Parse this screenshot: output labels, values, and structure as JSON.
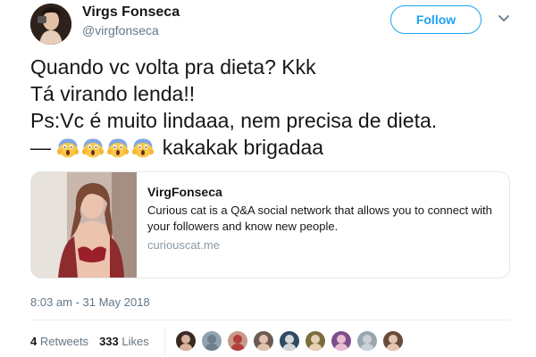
{
  "author": {
    "display_name": "Virgs Fonseca",
    "handle": "@virgfonseca"
  },
  "header": {
    "follow_label": "Follow",
    "menu_icon": "chevron-down-icon"
  },
  "tweet": {
    "lines": [
      "Quando vc volta pra dieta? Kkk",
      "Tá virando lenda!!",
      "Ps:Vc é muito lindaaa, nem precisa de dieta."
    ],
    "last_line_prefix": "—",
    "emoji_icon": "face-screaming-in-fear-icon",
    "emoji_count": 4,
    "last_line_suffix": "kakakak brigadaa"
  },
  "card": {
    "title": "VirgFonseca",
    "description": "Curious cat is a Q&A social network that allows you to connect with your followers and know new people.",
    "domain": "curiouscat.me"
  },
  "meta": {
    "timestamp": "8:03 am - 31 May 2018"
  },
  "stats": {
    "retweets_count": "4",
    "retweets_label": "Retweets",
    "likes_count": "333",
    "likes_label": "Likes"
  },
  "likers_count": 9,
  "colors": {
    "accent": "#1da1f2",
    "text": "#14171a",
    "secondary": "#657786",
    "border": "#e1e8ed"
  }
}
